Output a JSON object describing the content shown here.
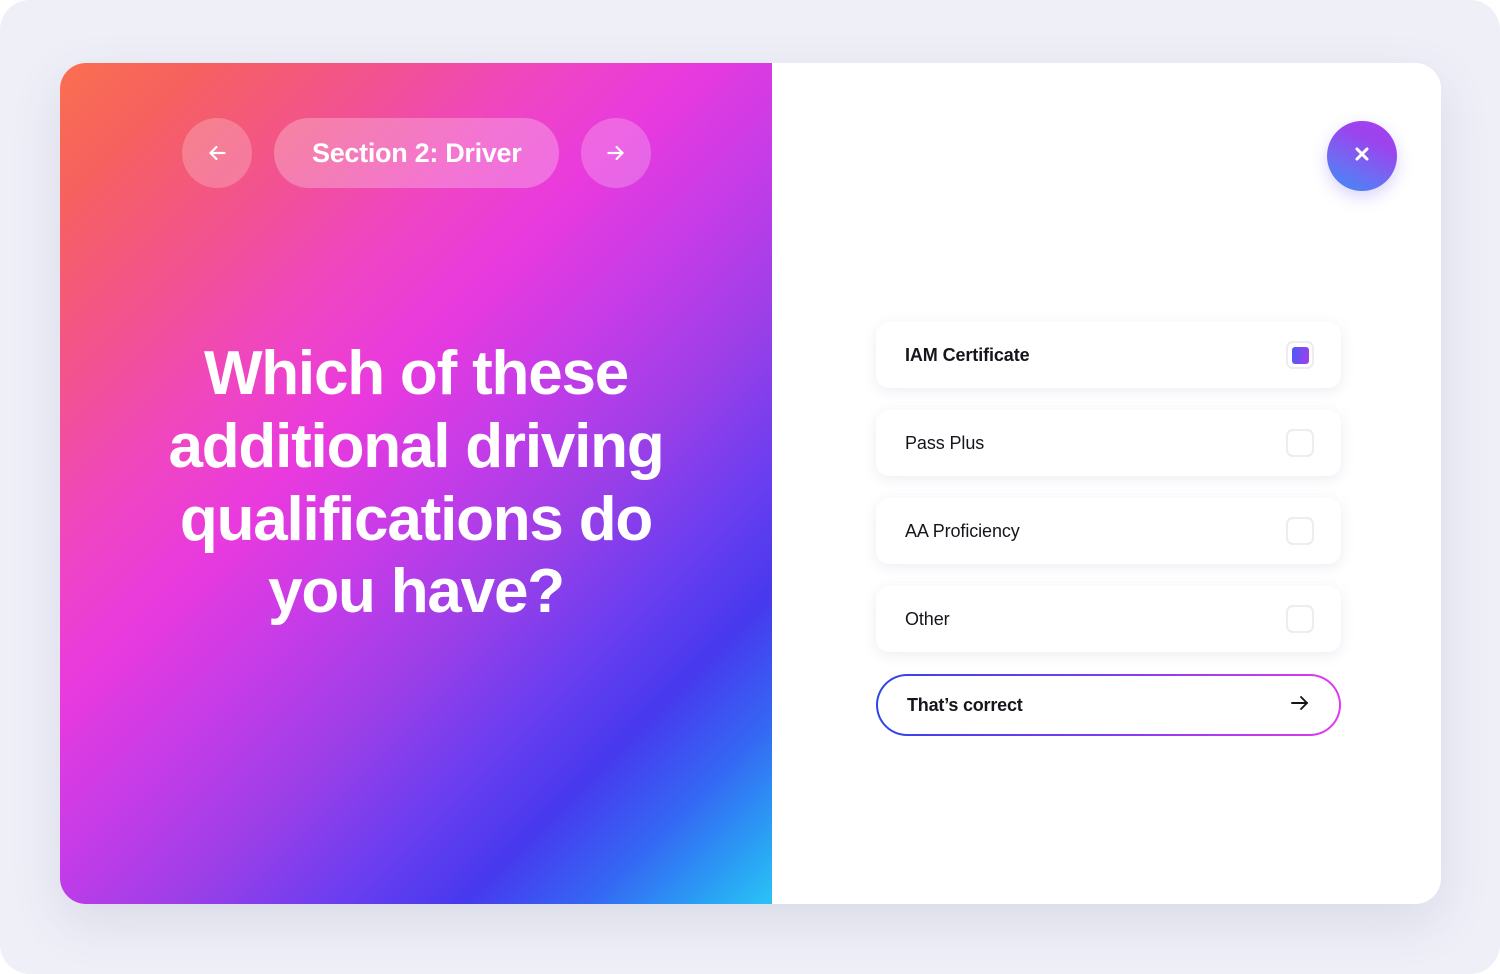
{
  "theme": {
    "page_background": "#EEEFF7",
    "gradient_start": "#FB6F50",
    "gradient_magenta": "#E93ADE",
    "gradient_violet": "#4739EE",
    "gradient_end": "#2AC3F6",
    "accent_blue": "#4B5BF5",
    "accent_purple": "#A93DE9",
    "text_dark": "#15151C"
  },
  "header": {
    "back_button_label": "Previous section",
    "back_icon": "arrow-left-icon",
    "section_title": "Section 2: Driver",
    "forward_button_label": "Next section",
    "forward_icon": "arrow-right-icon"
  },
  "question": {
    "text": "Which of these additional driving qualifications do you have?"
  },
  "close": {
    "label": "Close",
    "icon": "close-x-icon"
  },
  "options": [
    {
      "label": "IAM Certificate",
      "checked": true
    },
    {
      "label": "Pass Plus",
      "checked": false
    },
    {
      "label": "AA Proficiency",
      "checked": false
    },
    {
      "label": "Other",
      "checked": false
    }
  ],
  "cta": {
    "label": "That’s correct",
    "icon": "arrow-right-icon"
  }
}
